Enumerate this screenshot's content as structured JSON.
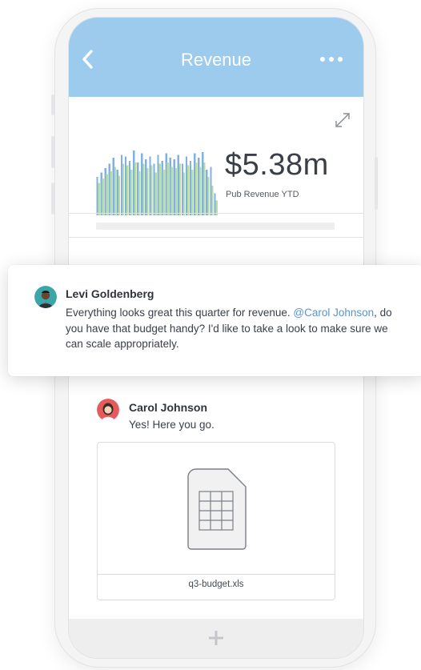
{
  "header": {
    "title": "Revenue"
  },
  "card": {
    "metric_value": "$5.38m",
    "metric_label": "Pub Revenue YTD"
  },
  "chart_data": {
    "type": "bar",
    "series": [
      {
        "name": "",
        "color": "#7fb2e0",
        "values": [
          0.52,
          0.58,
          0.64,
          0.7,
          0.78,
          0.62,
          0.82,
          0.8,
          0.74,
          0.88,
          0.72,
          0.84,
          0.76,
          0.8,
          0.7,
          0.82,
          0.74,
          0.84,
          0.78,
          0.76,
          0.82,
          0.7,
          0.8,
          0.74,
          0.84,
          0.78,
          0.86,
          0.62,
          0.66,
          0.3
        ]
      },
      {
        "name": "",
        "color": "#b8dea0",
        "values": [
          0.44,
          0.5,
          0.56,
          0.6,
          0.66,
          0.54,
          0.7,
          0.68,
          0.62,
          0.72,
          0.6,
          0.7,
          0.64,
          0.68,
          0.58,
          0.7,
          0.62,
          0.72,
          0.66,
          0.64,
          0.7,
          0.58,
          0.68,
          0.62,
          0.72,
          0.66,
          0.72,
          0.52,
          0.4,
          0.2
        ]
      }
    ]
  },
  "comment": {
    "author": "Levi Goldenberg",
    "text_before": "Everything looks great this quarter for revenue. ",
    "mention": "@Carol Johnson",
    "text_after": ", do you have that budget handy? I'd like to take a look to make sure we can scale appropriately."
  },
  "reply": {
    "author": "Carol Johnson",
    "text": "Yes! Here you go."
  },
  "attachment": {
    "filename": "q3-budget.xls"
  },
  "colors": {
    "header": "#9ccbee",
    "mention": "#5b93cf",
    "bar_blue": "#7fb2e0",
    "bar_green": "#b8dea0"
  },
  "icons": {
    "back": "chevron-left-icon",
    "more": "more-horizontal-icon",
    "expand": "expand-icon",
    "file": "spreadsheet-file-icon",
    "add": "plus-icon"
  }
}
